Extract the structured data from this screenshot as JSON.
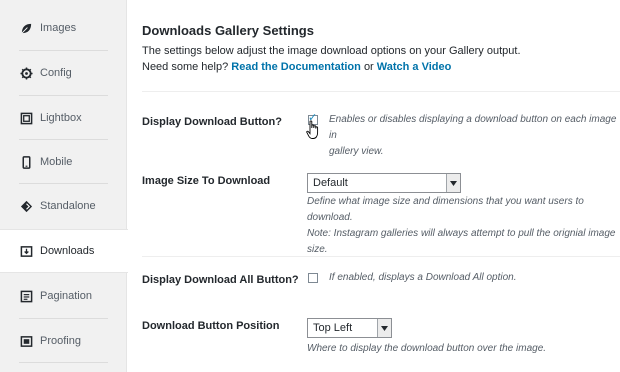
{
  "sidebar": {
    "items": [
      {
        "label": "Images",
        "icon": "leaf-icon"
      },
      {
        "label": "Config",
        "icon": "gear-icon"
      },
      {
        "label": "Lightbox",
        "icon": "lightbox-icon"
      },
      {
        "label": "Mobile",
        "icon": "mobile-icon"
      },
      {
        "label": "Standalone",
        "icon": "standalone-icon"
      },
      {
        "label": "Downloads",
        "icon": "download-icon"
      },
      {
        "label": "Pagination",
        "icon": "pagination-icon"
      },
      {
        "label": "Proofing",
        "icon": "proofing-icon"
      }
    ],
    "active": "Downloads"
  },
  "main": {
    "title": "Downloads Gallery Settings",
    "description_line1": "The settings below adjust the image download options on your Gallery output.",
    "help_prefix": "Need some help?",
    "doc_link": "Read the Documentation",
    "or_text": "or",
    "video_link": "Watch a Video"
  },
  "settings": {
    "display_download_button": {
      "label": "Display Download Button?",
      "checked": true,
      "help_line1": "Enables or disables displaying a download button on each image in",
      "help_line2": "gallery view."
    },
    "image_size": {
      "label": "Image Size To Download",
      "value": "Default",
      "help_line1": "Define what image size and dimensions that you want users to download.",
      "help_line2": "Note: Instagram galleries will always attempt to pull the orignial image",
      "help_line3": "size."
    },
    "display_download_all": {
      "label": "Display Download All Button?",
      "checked": false,
      "help": "If enabled, displays a Download All option."
    },
    "download_position": {
      "label": "Download Button Position",
      "value": "Top Left",
      "help": "Where to display the download button over the image."
    }
  },
  "colors": {
    "link": "#0073aa",
    "sidebar_bg": "#f1f1f1",
    "text": "#23282d"
  }
}
